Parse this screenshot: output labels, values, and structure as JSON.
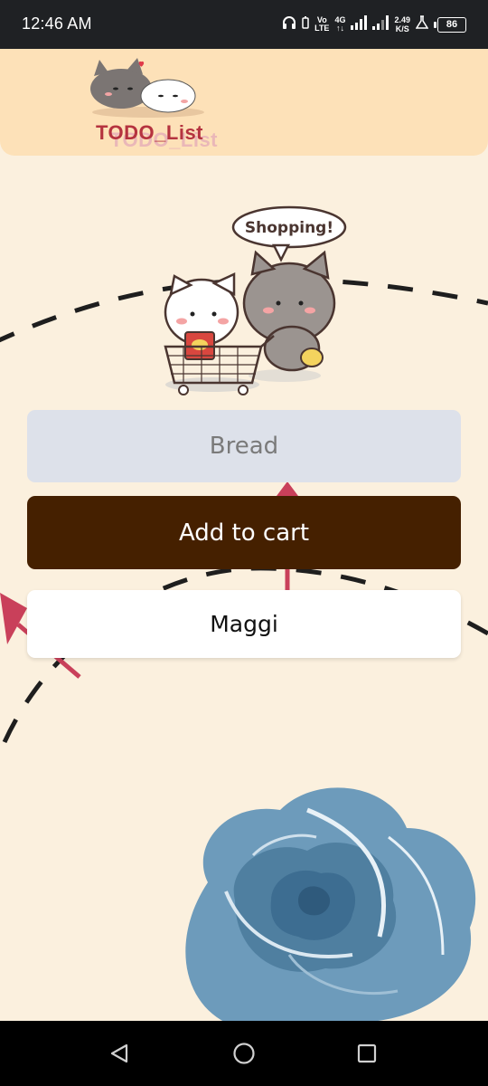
{
  "status_bar": {
    "time": "12:46 AM",
    "network_vo": "Vo",
    "network_lte": "LTE",
    "network_4g": "4G",
    "speed_value": "2.49",
    "speed_unit": "K/S",
    "battery": "86",
    "icons": [
      "headphones-icon",
      "signal-icon",
      "signal-icon",
      "flask-icon",
      "battery-icon"
    ]
  },
  "header": {
    "title": "TODO_List",
    "title_shadow": "TODO_List"
  },
  "illustration": {
    "speech_text": "Shopping!"
  },
  "form": {
    "input_placeholder": "Bread",
    "input_value": "",
    "add_button_label": "Add to cart"
  },
  "todo_items": [
    {
      "label": "Maggi"
    }
  ],
  "nav": {
    "icons": [
      "back-icon",
      "home-icon",
      "recents-icon"
    ]
  },
  "colors": {
    "background": "#fbf0de",
    "header_bg": "#fde1b8",
    "title_color": "#b5333f",
    "input_bg": "#dde1ea",
    "button_bg": "#452000",
    "arrow_color": "#c9405a",
    "rose_blue": "#4f7fa0"
  }
}
